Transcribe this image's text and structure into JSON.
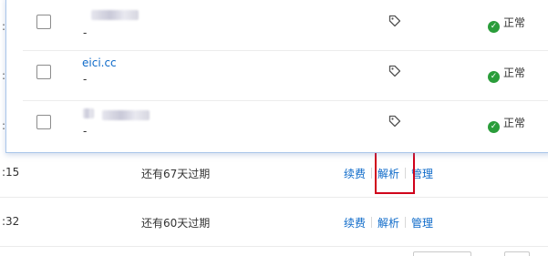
{
  "background_table": {
    "rows": [
      {
        "time": ":15",
        "expire": "还有67天过期",
        "actions": [
          "续费",
          "解析",
          "管理"
        ]
      },
      {
        "time": ":32",
        "expire": "还有60天过期",
        "actions": [
          "续费",
          "解析",
          "管理"
        ]
      }
    ],
    "left_ticks": [
      ":",
      ":",
      ":"
    ]
  },
  "popup": {
    "rows": [
      {
        "domain": "",
        "sub": "-",
        "status": "正常",
        "icon": "tag-icon",
        "status_icon": "check-circle-icon"
      },
      {
        "domain": "eici.cc",
        "sub": "-",
        "status": "正常",
        "icon": "tag-icon",
        "status_icon": "check-circle-icon"
      },
      {
        "domain": "",
        "sub": "-",
        "status": "正常",
        "icon": "tag-icon",
        "status_icon": "check-circle-icon"
      }
    ]
  },
  "colors": {
    "link": "#0e6ac9",
    "highlight": "#d0021b",
    "status_ok": "#2a9d3a",
    "panel_border": "#a9c6ea"
  }
}
